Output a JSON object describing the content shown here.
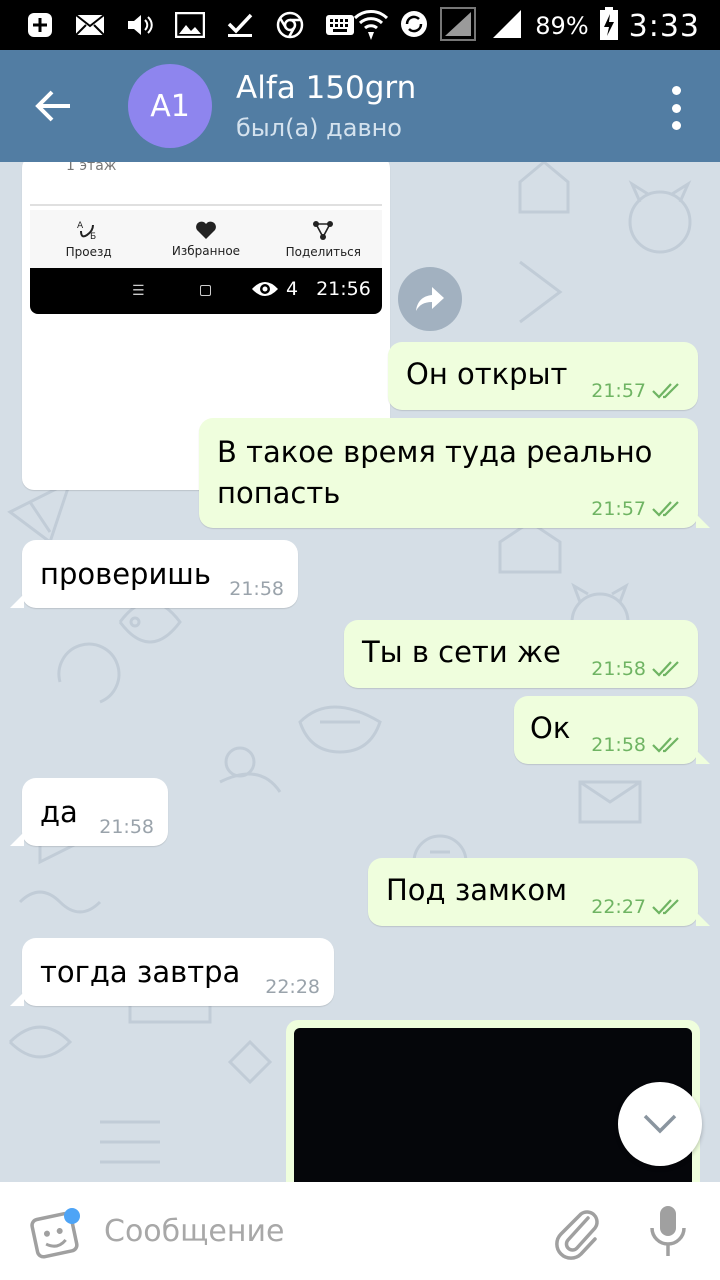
{
  "status_bar": {
    "battery_percent": "89%",
    "time": "3:33",
    "icons_left": [
      "add-icon",
      "mail-icon",
      "volume-icon",
      "gallery-icon",
      "check-icon",
      "chrome-icon",
      "keyboard-icon"
    ],
    "icons_right": [
      "wifi-icon",
      "sync-icon",
      "signal-icon",
      "signal-icon",
      "battery-icon"
    ]
  },
  "header": {
    "avatar_initials": "A1",
    "title": "Alfa 150grn",
    "status": "был(а) давно",
    "avatar_color": "#8e85ee",
    "bar_color": "#527da3"
  },
  "forwarded_card": {
    "floor_text": "1 этаж",
    "actions": [
      {
        "label": "Проезд",
        "icon": "route-icon"
      },
      {
        "label": "Избранное",
        "icon": "heart-icon"
      },
      {
        "label": "Поделиться",
        "icon": "share-icon"
      }
    ],
    "views": "4",
    "time": "21:56"
  },
  "messages": [
    {
      "direction": "out",
      "text": "Он открыт",
      "time": "21:57"
    },
    {
      "direction": "out",
      "text_line1": "В такое время туда реально",
      "text_line2": "попасть",
      "time": "21:57"
    },
    {
      "direction": "in",
      "text": "проверишь",
      "time": "21:58"
    },
    {
      "direction": "out",
      "text": "Ты в сети же",
      "time": "21:58"
    },
    {
      "direction": "out",
      "text": "Ок",
      "time": "21:58"
    },
    {
      "direction": "in",
      "text": "да",
      "time": "21:58"
    },
    {
      "direction": "out",
      "text": "Под замком",
      "time": "22:27"
    },
    {
      "direction": "in",
      "text": "тогда завтра",
      "time": "22:28"
    }
  ],
  "input": {
    "placeholder": "Сообщение"
  },
  "colors": {
    "outgoing_bubble": "#effedd",
    "incoming_bubble": "#ffffff",
    "read_check": "#6fb463",
    "chat_background": "#d5dee6"
  }
}
